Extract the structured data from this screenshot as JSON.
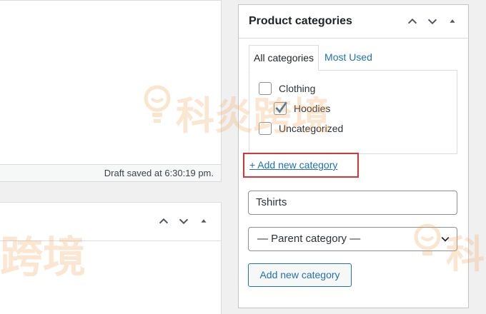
{
  "editor": {
    "draft_status": "Draft saved at 6:30:19 pm."
  },
  "meta_box": {
    "title": "Product categories",
    "tabs": [
      "All categories",
      "Most Used"
    ],
    "categories": [
      {
        "label": "Clothing",
        "checked": false,
        "level": 0
      },
      {
        "label": "Hoodies",
        "checked": true,
        "level": 1
      },
      {
        "label": "Uncategorized",
        "checked": false,
        "level": 0
      }
    ],
    "add_new_link": "+ Add new category",
    "new_category_value": "Tshirts",
    "parent_select_value": "— Parent category —",
    "add_button": "Add new category"
  },
  "watermark": {
    "text_full": "科炎跨境",
    "text_partial_left": "跨境",
    "text_partial_right": "科"
  },
  "colors": {
    "link": "#2271b1",
    "highlight_border": "#d63638",
    "watermark": "#f0aa5a"
  }
}
